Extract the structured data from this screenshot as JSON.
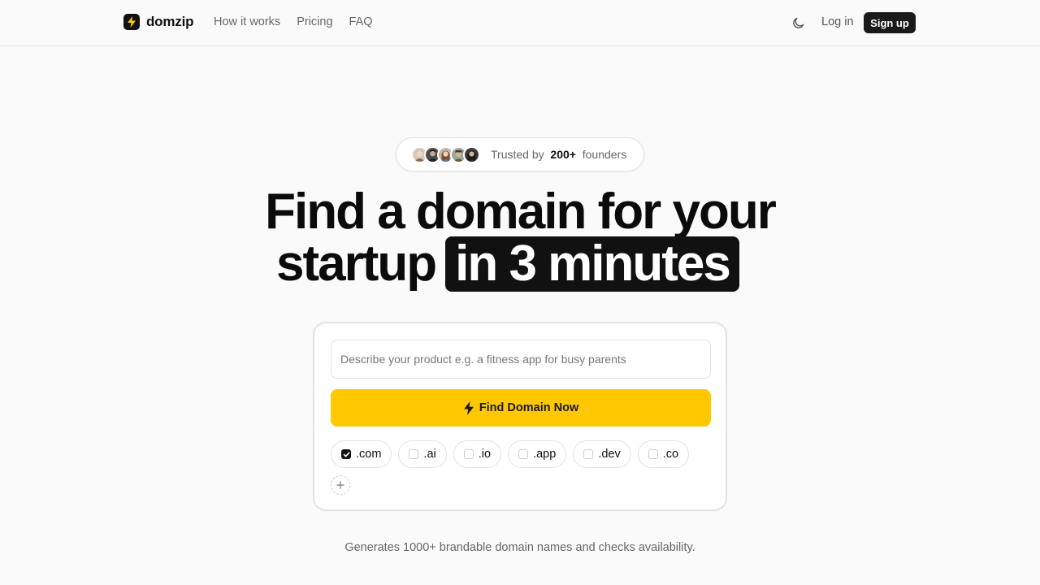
{
  "header": {
    "brand": "domzip",
    "nav": [
      "How it works",
      "Pricing",
      "FAQ"
    ],
    "theme_icon": "moon-icon",
    "login_label": "Log in",
    "signup_label": "Sign up"
  },
  "hero": {
    "trust": {
      "prefix": "Trusted by",
      "count": "200+",
      "suffix": "founders",
      "avatar_count": 5
    },
    "headline_line1": "Find a domain for your",
    "headline_line2_plain": "startup",
    "headline_line2_highlight": "in 3 minutes"
  },
  "search": {
    "placeholder": "Describe your product e.g. a fitness app for busy parents",
    "value": "",
    "button_label": "Find Domain Now",
    "button_icon": "lightning-icon",
    "tlds": [
      {
        "label": ".com",
        "checked": true
      },
      {
        "label": ".ai",
        "checked": false
      },
      {
        "label": ".io",
        "checked": false
      },
      {
        "label": ".app",
        "checked": false
      },
      {
        "label": ".dev",
        "checked": false
      },
      {
        "label": ".co",
        "checked": false
      }
    ],
    "add_tld_icon": "plus-icon"
  },
  "footer_note": "Generates 1000+ brandable domain names and checks availability.",
  "colors": {
    "accent": "#ffc800",
    "dark": "#111111",
    "background": "#fafafa"
  }
}
